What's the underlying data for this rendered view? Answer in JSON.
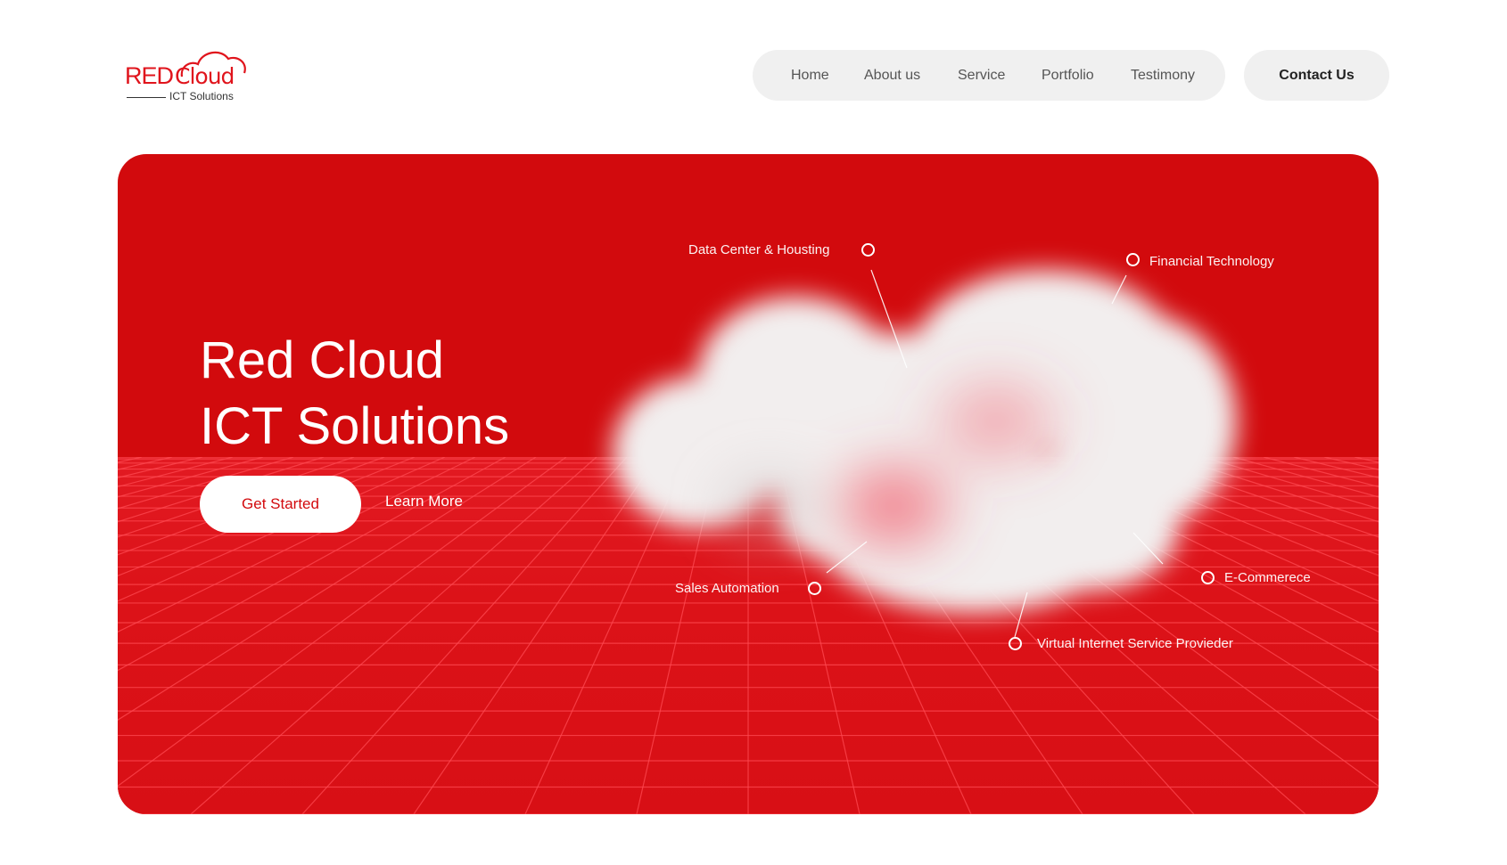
{
  "logo": {
    "word_red": "RED",
    "word_cloud": "Cloud",
    "subtitle": "ICT Solutions"
  },
  "nav": {
    "items": [
      {
        "label": "Home"
      },
      {
        "label": "About us"
      },
      {
        "label": "Service"
      },
      {
        "label": "Portfolio"
      },
      {
        "label": "Testimony"
      }
    ],
    "contact_label": "Contact Us"
  },
  "hero": {
    "title_line1": "Red Cloud",
    "title_line2": "ICT Solutions",
    "primary_button": "Get Started",
    "secondary_button": "Learn More",
    "services": {
      "data_center": "Data Center & Housting",
      "fintech": "Financial Technology",
      "sales": "Sales Automation",
      "ecommerce": "E-Commerece",
      "visp": "Virtual Internet Service Provieder"
    }
  },
  "colors": {
    "brand_red": "#d20a0d",
    "nav_bg": "#f0f0f0",
    "white": "#ffffff"
  },
  "icons": {
    "logo": "cloud-logo-icon",
    "service_marker": "circle-marker-icon"
  }
}
